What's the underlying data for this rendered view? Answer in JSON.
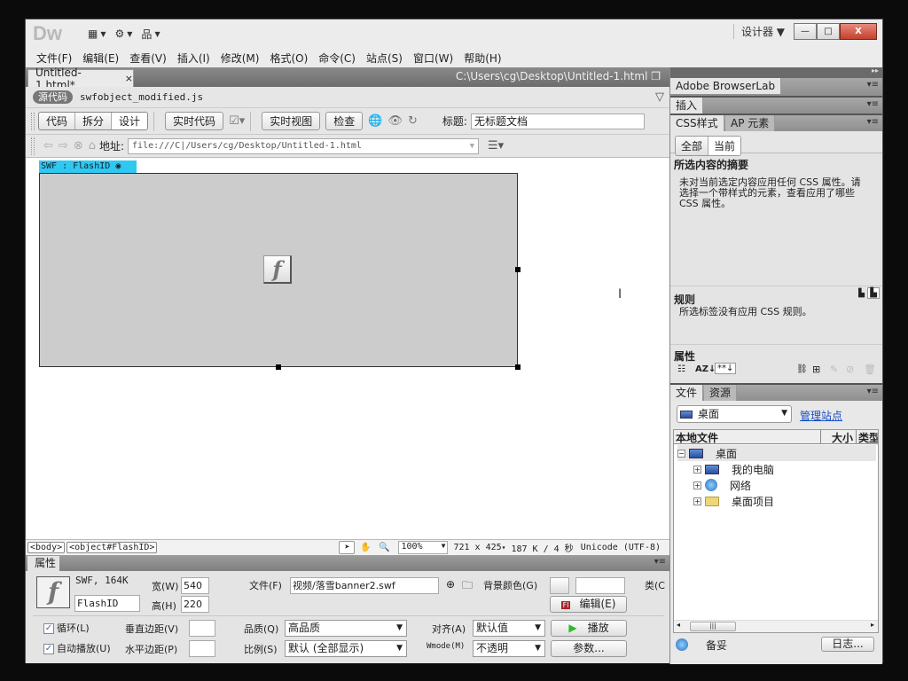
{
  "app": {
    "logo": "Dw",
    "workspace": "设计器",
    "window_controls": {
      "minimize": "—",
      "restore": "□",
      "close": "X"
    }
  },
  "menu": [
    "文件(F)",
    "编辑(E)",
    "查看(V)",
    "插入(I)",
    "修改(M)",
    "格式(O)",
    "命令(C)",
    "站点(S)",
    "窗口(W)",
    "帮助(H)"
  ],
  "document": {
    "tab_label": "Untitled-1.html*",
    "tab_close": "×",
    "path": "C:\\Users\\cg\\Desktop\\Untitled-1.html",
    "source_badge": "源代码",
    "related_file": "swfobject_modified.js"
  },
  "toolbar": {
    "view_modes": [
      "代码",
      "拆分",
      "设计"
    ],
    "active_view": "设计",
    "live_code": "实时代码",
    "live_view": "实时视图",
    "inspect": "检查",
    "title_label": "标题:",
    "title_value": "无标题文档"
  },
  "address": {
    "label": "地址:",
    "value": "file:///C|/Users/cg/Desktop/Untitled-1.html"
  },
  "canvas": {
    "swf_tag": "SWF : FlashID",
    "flash_glyph": "f"
  },
  "statusbar": {
    "tags": [
      "<body>",
      "<object#FlashID>"
    ],
    "zoom": "100%",
    "window_size": "721 x 425",
    "download": "187 K / 4 秒",
    "encoding": "Unicode (UTF-8)"
  },
  "properties": {
    "header": "属性",
    "type_size": "SWF, 164K",
    "id_value": "FlashID",
    "width_label": "宽(W)",
    "width_value": "540",
    "height_label": "高(H)",
    "height_value": "220",
    "file_label": "文件(F)",
    "file_value": "视频/落雪banner2.swf",
    "bgcolor_label": "背景颜色(G)",
    "class_label": "类(C",
    "edit_button": "编辑(E)",
    "loop_label": "循环(L)",
    "loop_checked": true,
    "autoplay_label": "自动播放(U)",
    "autoplay_checked": true,
    "vspace_label": "垂直边距(V)",
    "hspace_label": "水平边距(P)",
    "quality_label": "品质(Q)",
    "quality_value": "高品质",
    "scale_label": "比例(S)",
    "scale_value": "默认 (全部显示)",
    "align_label": "对齐(A)",
    "align_value": "默认值",
    "wmode_label": "Wmode(M)",
    "wmode_value": "不透明",
    "play_button": "播放",
    "params_button": "参数..."
  },
  "panels": {
    "browserlab": "Adobe BrowserLab",
    "insert": "插入",
    "css_tab": "CSS样式",
    "ap_tab": "AP 元素",
    "css_modes": [
      "全部",
      "当前"
    ],
    "summary_title": "所选内容的摘要",
    "summary_text": "未对当前选定内容应用任何 CSS 属性。请选择一个带样式的元素，查看应用了哪些 CSS 属性。",
    "rules_title": "规则",
    "rules_text": "所选标签没有应用 CSS 规则。",
    "props_title": "属性",
    "files_tab": "文件",
    "assets_tab": "资源",
    "location": "桌面",
    "manage_sites": "管理站点",
    "columns": [
      "本地文件",
      "大小",
      "类型"
    ],
    "tree": [
      {
        "label": "桌面",
        "level": 0,
        "icon": "monitor-icon",
        "toggle": "−"
      },
      {
        "label": "我的电脑",
        "level": 1,
        "icon": "computer-icon",
        "toggle": "+"
      },
      {
        "label": "网络",
        "level": 1,
        "icon": "network-icon",
        "toggle": "+"
      },
      {
        "label": "桌面项目",
        "level": 1,
        "icon": "folder-icon",
        "toggle": "+"
      }
    ],
    "footer_status": "备妥",
    "log_button": "日志..."
  }
}
